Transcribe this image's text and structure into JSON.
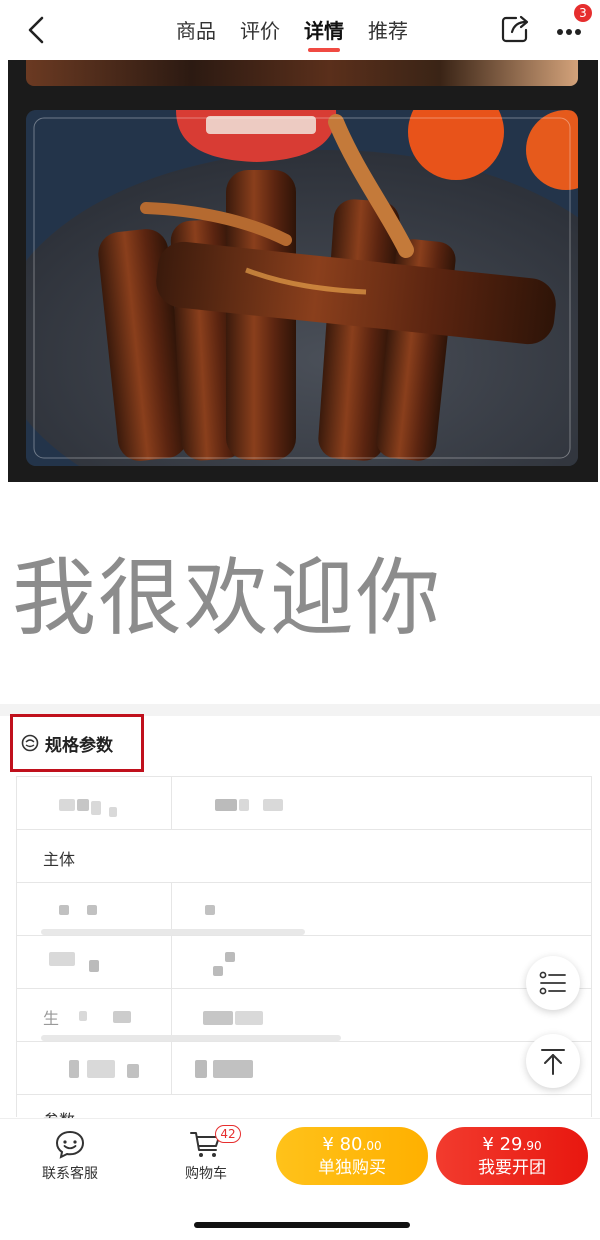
{
  "nav": {
    "tabs": [
      {
        "label": "商品",
        "active": false
      },
      {
        "label": "评价",
        "active": false
      },
      {
        "label": "详情",
        "active": true
      },
      {
        "label": "推荐",
        "active": false
      }
    ],
    "more_badge": "3",
    "icons": {
      "back": "chevron-left-icon",
      "share": "share-icon",
      "more": "more-dots-icon"
    }
  },
  "greeting": "我很欢迎你",
  "specs": {
    "title": "规格参数",
    "rows": [
      {
        "label": ""
      },
      {
        "label": "主体"
      },
      {
        "label": ""
      },
      {
        "label": ""
      },
      {
        "label": "生"
      },
      {
        "label": ""
      },
      {
        "label": "参数"
      }
    ]
  },
  "bottom": {
    "service_label": "联系客服",
    "cart_label": "购物车",
    "cart_count": "42",
    "solo": {
      "currency": "¥",
      "price_int": "80",
      "price_dec": ".00",
      "label": "单独购买"
    },
    "group": {
      "currency": "¥",
      "price_int": "29",
      "price_dec": ".90",
      "label": "我要开团"
    }
  },
  "colors": {
    "accent": "#f04a42",
    "solo": "#ffb000",
    "group": "#e8170f",
    "highlight_box": "#c0101c"
  }
}
